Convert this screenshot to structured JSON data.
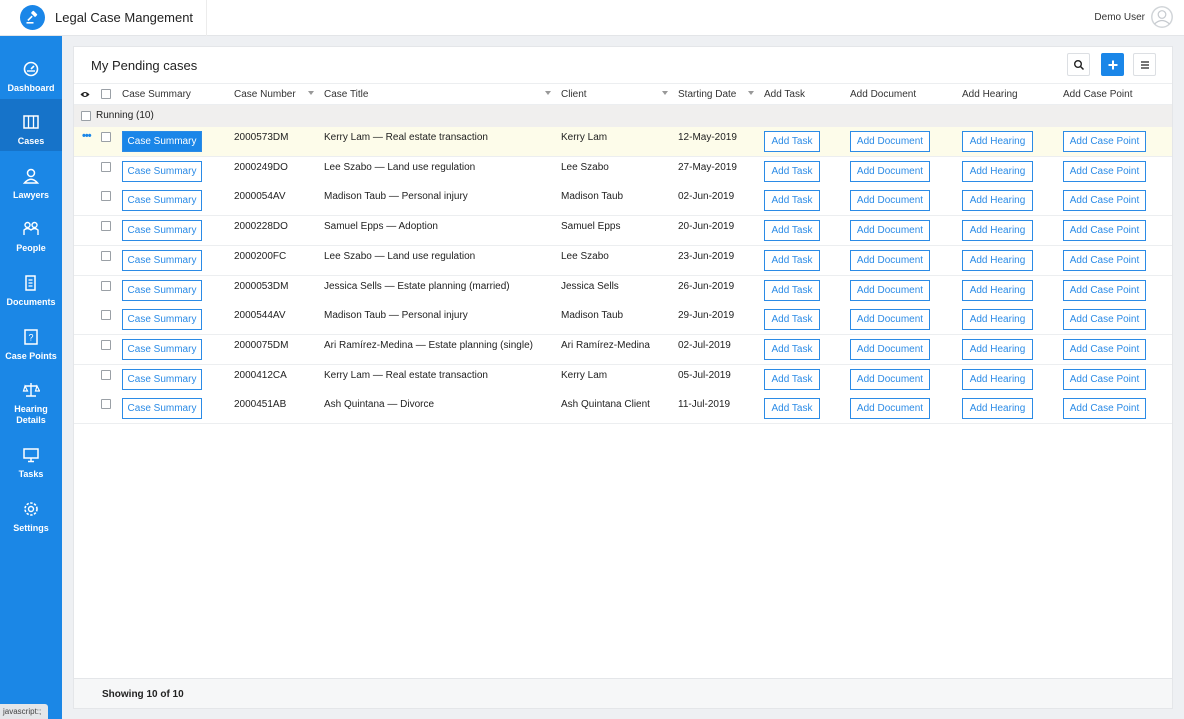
{
  "app": {
    "title": "Legal Case Mangement",
    "user_name": "Demo User",
    "accent": "#1a86e8"
  },
  "sidebar": {
    "items": [
      {
        "label": "Dashboard",
        "icon": "dashboard-icon"
      },
      {
        "label": "Cases",
        "icon": "cases-icon",
        "active": true
      },
      {
        "label": "Lawyers",
        "icon": "lawyers-icon"
      },
      {
        "label": "People",
        "icon": "people-icon"
      },
      {
        "label": "Documents",
        "icon": "documents-icon"
      },
      {
        "label": "Case Points",
        "icon": "case-points-icon"
      },
      {
        "label": "Hearing Details",
        "icon": "hearing-icon"
      },
      {
        "label": "Tasks",
        "icon": "tasks-icon"
      },
      {
        "label": "Settings",
        "icon": "settings-icon"
      }
    ],
    "status_hint": "javascript:;"
  },
  "panel": {
    "title": "My Pending cases"
  },
  "grid": {
    "columns": [
      "Case Summary",
      "Case Number",
      "Case Title",
      "Client",
      "Starting Date",
      "Add Task",
      "Add Document",
      "Add Hearing",
      "Add Case Point"
    ],
    "group_label": "Running (10)",
    "button_labels": {
      "case_summary": "Case Summary",
      "add_task": "Add Task",
      "add_document": "Add Document",
      "add_hearing": "Add Hearing",
      "add_case_point": "Add Case Point"
    },
    "rows": [
      {
        "number": "2000573DM",
        "title": "Kerry Lam — Real estate transaction",
        "client": "Kerry Lam",
        "date": "12-May-2019",
        "selected": true
      },
      {
        "number": "2000249DO",
        "title": "Lee Szabo — Land use regulation",
        "client": "Lee Szabo",
        "date": "27-May-2019"
      },
      {
        "number": "2000054AV",
        "title": "Madison Taub — Personal injury",
        "client": "Madison Taub",
        "date": "02-Jun-2019"
      },
      {
        "number": "2000228DO",
        "title": "Samuel Epps — Adoption",
        "client": "Samuel Epps",
        "date": "20-Jun-2019"
      },
      {
        "number": "2000200FC",
        "title": "Lee Szabo — Land use regulation",
        "client": "Lee Szabo",
        "date": "23-Jun-2019"
      },
      {
        "number": "2000053DM",
        "title": "Jessica Sells — Estate planning (married)",
        "client": "Jessica Sells",
        "date": "26-Jun-2019"
      },
      {
        "number": "2000544AV",
        "title": "Madison Taub — Personal injury",
        "client": "Madison Taub",
        "date": "29-Jun-2019"
      },
      {
        "number": "2000075DM",
        "title": "Ari Ramírez-Medina — Estate planning (single)",
        "client": "Ari Ramírez-Medina",
        "date": "02-Jul-2019"
      },
      {
        "number": "2000412CA",
        "title": "Kerry Lam — Real estate transaction",
        "client": "Kerry Lam",
        "date": "05-Jul-2019"
      },
      {
        "number": "2000451AB",
        "title": "Ash Quintana — Divorce",
        "client": "Ash Quintana Client",
        "date": "11-Jul-2019"
      }
    ]
  },
  "footer": {
    "text": "Showing 10 of 10"
  }
}
